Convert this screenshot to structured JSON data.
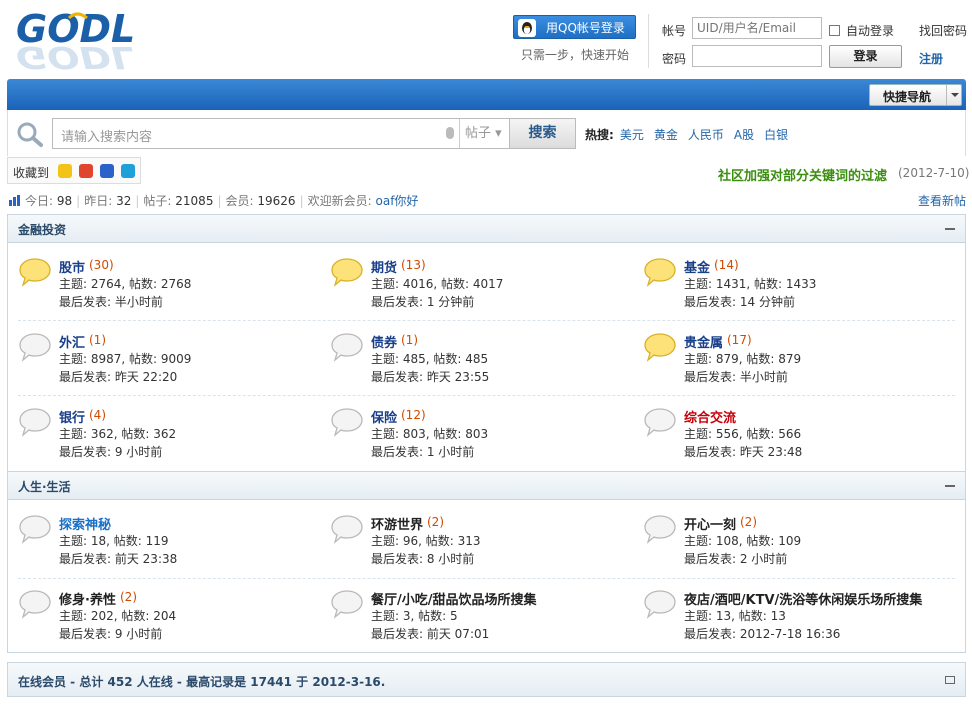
{
  "header": {
    "logo_text": "GODL",
    "qq_login_label": "用QQ帐号登录",
    "qq_subtitle": "只需一步，快速开始",
    "account_label": "帐号",
    "account_placeholder": "UID/用户名/Email",
    "password_label": "密码",
    "auto_login_label": "自动登录",
    "forgot_password": "找回密码",
    "login_button": "登录",
    "register": "注册"
  },
  "nav": {
    "quick_nav_label": "快捷导航"
  },
  "search": {
    "placeholder": "请输入搜索内容",
    "scope": "帖子",
    "button": "搜索",
    "hot_label": "热搜:",
    "hot_terms": [
      "美元",
      "黄金",
      "人民币",
      "A股",
      "白银"
    ]
  },
  "favorite": {
    "label": "收藏到"
  },
  "notice": {
    "text": "社区加强对部分关键词的过滤",
    "date": "(2012-7-10)"
  },
  "stats": {
    "today_label": "今日:",
    "today": "98",
    "yesterday_label": "昨日:",
    "yesterday": "32",
    "posts_label": "帖子:",
    "posts": "21085",
    "members_label": "会员:",
    "members": "19626",
    "welcome_label": "欢迎新会员:",
    "new_member": "oaf你好",
    "view_new": "查看新帖"
  },
  "sections": [
    {
      "title": "金融投资",
      "forums": [
        {
          "name": "股市",
          "count": "(30)",
          "topics": "主题: 2764, 帖数: 2768",
          "last": "最后发表: 半小时前",
          "new": true
        },
        {
          "name": "期货",
          "count": "(13)",
          "topics": "主题: 4016, 帖数: 4017",
          "last": "最后发表: 1 分钟前",
          "new": true
        },
        {
          "name": "基金",
          "count": "(14)",
          "topics": "主题: 1431, 帖数: 1433",
          "last": "最后发表: 14 分钟前",
          "new": true
        },
        {
          "name": "外汇",
          "count": "(1)",
          "topics": "主题: 8987, 帖数: 9009",
          "last": "最后发表: 昨天 22:20",
          "new": false
        },
        {
          "name": "债券",
          "count": "(1)",
          "topics": "主题: 485, 帖数: 485",
          "last": "最后发表: 昨天 23:55",
          "new": false
        },
        {
          "name": "贵金属",
          "count": "(17)",
          "topics": "主题: 879, 帖数: 879",
          "last": "最后发表: 半小时前",
          "new": true
        },
        {
          "name": "银行",
          "count": "(4)",
          "topics": "主题: 362, 帖数: 362",
          "last": "最后发表: 9 小时前",
          "new": false
        },
        {
          "name": "保险",
          "count": "(12)",
          "topics": "主题: 803, 帖数: 803",
          "last": "最后发表: 1 小时前",
          "new": false
        },
        {
          "name": "综合交流",
          "count": "",
          "topics": "主题: 556, 帖数: 566",
          "last": "最后发表: 昨天 23:48",
          "new": false,
          "red": true
        }
      ]
    },
    {
      "title": "人生·生活",
      "forums": [
        {
          "name": "探索神秘",
          "count": "",
          "topics": "主题: 18, 帖数: 119",
          "last": "最后发表: 前天 23:38",
          "new": false,
          "blue": true
        },
        {
          "name": "环游世界",
          "count": "(2)",
          "topics": "主题: 96, 帖数: 313",
          "last": "最后发表: 8 小时前",
          "new": false,
          "dark": true
        },
        {
          "name": "开心一刻",
          "count": "(2)",
          "topics": "主题: 108, 帖数: 109",
          "last": "最后发表: 2 小时前",
          "new": false,
          "dark": true
        },
        {
          "name": "修身·养性",
          "count": "(2)",
          "topics": "主题: 202, 帖数: 204",
          "last": "最后发表: 9 小时前",
          "new": false,
          "dark": true
        },
        {
          "name": "餐厅/小吃/甜品饮品场所搜集",
          "count": "",
          "topics": "主题: 3, 帖数: 5",
          "last": "最后发表: 前天 07:01",
          "new": false,
          "dark": true
        },
        {
          "name": "夜店/酒吧/KTV/洗浴等休闲娱乐场所搜集",
          "count": "",
          "topics": "主题: 13, 帖数: 13",
          "last": "最后发表: 2012-7-18 16:36",
          "new": false,
          "dark": true
        }
      ]
    }
  ],
  "online": {
    "text": "在线会员 - 总计 452 人在线 - 最高记录是 17441 于 2012-3-16."
  }
}
